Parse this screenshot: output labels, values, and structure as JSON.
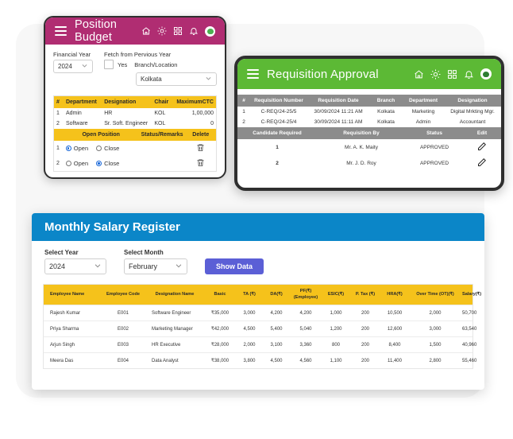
{
  "position_budget": {
    "title": "Position Budget",
    "icons": [
      "home-icon",
      "brightness-icon",
      "apps-grid-icon",
      "bell-icon",
      "avatar-icon"
    ],
    "financial_year": {
      "label": "Financial Year",
      "value": "2024"
    },
    "fetch_prev": {
      "label": "Fetch from Pervious Year",
      "checkbox_label": "Yes"
    },
    "branch": {
      "label": "Branch/Location",
      "value": "Kolkata"
    },
    "table": {
      "headers": [
        "#",
        "Department",
        "Designation",
        "Chair",
        "MaximumCTC"
      ],
      "rows": [
        [
          "1",
          "Admin",
          "HR",
          "KOL",
          "1,00,000"
        ],
        [
          "2",
          "Software",
          "Sr. Soft. Engineer",
          "KOL",
          "0"
        ]
      ]
    },
    "sub_table": {
      "headers": [
        "Open Position",
        "Status/Remarks",
        "Delete"
      ],
      "rows": [
        {
          "num": "1",
          "open_label": "Open",
          "close_label": "Close",
          "selected": "Open",
          "status": "",
          "delete_icon": "trash-icon"
        },
        {
          "num": "2",
          "open_label": "Open",
          "close_label": "Close",
          "selected": "Close",
          "status": "",
          "delete_icon": "trash-icon"
        }
      ]
    }
  },
  "requisition_approval": {
    "title": "Requisition Approval",
    "icons": [
      "home-icon",
      "brightness-icon",
      "apps-grid-icon",
      "bell-icon",
      "avatar-icon"
    ],
    "table": {
      "headers": [
        "#",
        "Requisition Number",
        "Requisition Date",
        "Branch",
        "Department",
        "Designation"
      ],
      "rows": [
        [
          "1",
          "C-REQ/24-25/5",
          "30/09/2024 11:21 AM",
          "Kolkata",
          "Marketing",
          "Digital Mrkting Mgr."
        ],
        [
          "2",
          "C-REQ/24-25/4",
          "30/09/2024 11:11 AM",
          "Kolkata",
          "Admin",
          "Accountant"
        ]
      ]
    },
    "sub_table": {
      "headers": [
        "Candidate Required",
        "Requisition By",
        "Status",
        "Edit"
      ],
      "rows": [
        {
          "candidate_required": "1",
          "requisition_by": "Mr. A. K. Maity",
          "status": "APPROVED",
          "edit_icon": "pencil-icon"
        },
        {
          "candidate_required": "2",
          "requisition_by": "Mr. J. D. Roy",
          "status": "APPROVED",
          "edit_icon": "pencil-icon"
        }
      ]
    }
  },
  "salary_register": {
    "title": "Monthly Salary Register",
    "select_year": {
      "label": "Select Year",
      "value": "2024"
    },
    "select_month": {
      "label": "Select Month",
      "value": "February"
    },
    "show_data_button": "Show Data",
    "table": {
      "headers": [
        "Employee Name",
        "Employee Code",
        "Designation Name",
        "Basic",
        "TA (₹)",
        "DA(₹)",
        "PF(₹)\n(Employee)",
        "ESIC(₹)",
        "P. Tax (₹)",
        "HRA(₹)",
        "Over Time (OT)(₹)",
        "Salary(₹)"
      ],
      "rows": [
        [
          "Rajesh Kumar",
          "E001",
          "Software Engineer",
          "₹35,000",
          "3,000",
          "4,200",
          "4,200",
          "1,000",
          "200",
          "10,500",
          "2,000",
          "50,700"
        ],
        [
          "Priya Sharma",
          "E002",
          "Marketing Manager",
          "₹42,000",
          "4,500",
          "5,400",
          "5,040",
          "1,200",
          "200",
          "12,600",
          "3,000",
          "63,540"
        ],
        [
          "Arjun Singh",
          "E003",
          "HR Executive",
          "₹28,000",
          "2,000",
          "3,100",
          "3,360",
          "800",
          "200",
          "8,400",
          "1,500",
          "40,960"
        ],
        [
          "Meera Das",
          "E004",
          "Data Analyst",
          "₹38,000",
          "3,800",
          "4,500",
          "4,560",
          "1,100",
          "200",
          "11,400",
          "2,800",
          "55,460"
        ]
      ]
    }
  },
  "colors": {
    "magenta": "#b02d72",
    "green": "#5cb935",
    "blue": "#0b86c8",
    "yellow": "#f5c21b",
    "gray_header": "#8c8c8c",
    "purple": "#5b5fd6"
  }
}
